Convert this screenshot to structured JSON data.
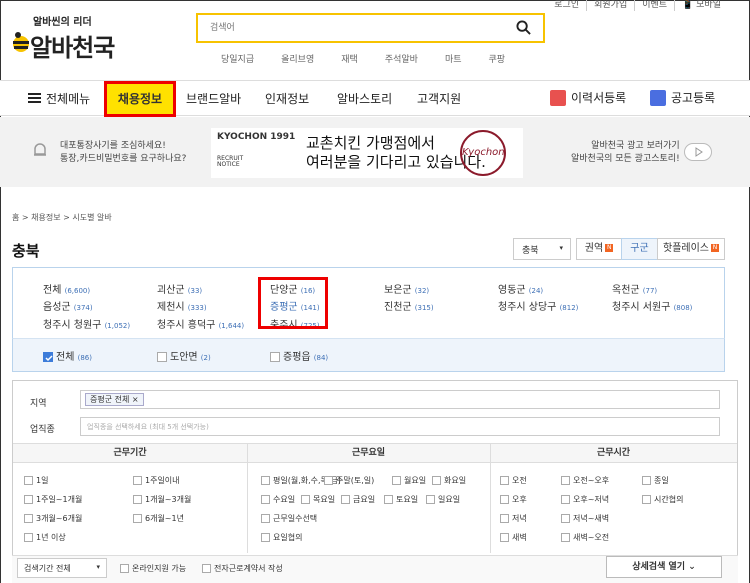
{
  "util_links": [
    "로그인",
    "회원가입",
    "이벤트",
    "모바일"
  ],
  "logo": {
    "tagline": "알바씬의 리더",
    "name": "알바천국"
  },
  "search": {
    "placeholder": "검색어"
  },
  "quick_links": [
    "당일지급",
    "올리브영",
    "재택",
    "주석알바",
    "마트",
    "쿠팡"
  ],
  "gnb": {
    "menu": "전체메뉴",
    "items": [
      "채용정보",
      "브랜드알바",
      "인재정보",
      "알바스토리",
      "고객지원"
    ],
    "resume": "이력서등록",
    "post": "공고등록"
  },
  "banner": {
    "left_line1": "대포통장사기를 조심하세요!",
    "left_line2": "통장,카드비밀번호를 요구하나요?",
    "ad_brand": "KYOCHON 1991",
    "ad_sub1": "RECRUIT",
    "ad_sub2": "NOTICE",
    "ad_line1": "교촌치킨 가맹점에서",
    "ad_line2": "여러분을 기다리고 있습니다.",
    "ad_logo": "Kyochon",
    "right_line1": "알바천국 광고 보러가기",
    "right_line2": "알바천국의 모든 광고스토리!"
  },
  "breadcrumb": "홈 > 채용정보 > 시도별 알바",
  "page_title": "충북",
  "controls": {
    "select": "충북",
    "tab1": "권역",
    "tab2": "구군",
    "tab3": "핫플레이스",
    "badge": "N"
  },
  "regions": [
    [
      {
        "name": "전체",
        "count": "(6,600)"
      },
      {
        "name": "괴산군",
        "count": "(33)"
      },
      {
        "name": "단양군",
        "count": "(16)"
      },
      {
        "name": "보은군",
        "count": "(32)"
      },
      {
        "name": "영동군",
        "count": "(24)"
      },
      {
        "name": "옥천군",
        "count": "(77)"
      }
    ],
    [
      {
        "name": "음성군",
        "count": "(374)"
      },
      {
        "name": "제천시",
        "count": "(333)"
      },
      {
        "name": "증평군",
        "count": "(141)"
      },
      {
        "name": "진천군",
        "count": "(315)"
      },
      {
        "name": "청주시 상당구",
        "count": "(812)"
      },
      {
        "name": "청주시 서원구",
        "count": "(808)"
      }
    ],
    [
      {
        "name": "청주시 청원구",
        "count": "(1,052)"
      },
      {
        "name": "청주시 흥덕구",
        "count": "(1,644)"
      },
      {
        "name": "충주시",
        "count": "(725)"
      }
    ]
  ],
  "sub_regions": [
    {
      "name": "전체",
      "count": "(86)",
      "checked": true
    },
    {
      "name": "도안면",
      "count": "(2)",
      "checked": false
    },
    {
      "name": "증평읍",
      "count": "(84)",
      "checked": false
    }
  ],
  "filter": {
    "region_label": "지역",
    "region_tag": "증평군 전체",
    "job_label": "업직종",
    "job_placeholder": "업직종을 선택하세요 (최대 5개 선택가능)",
    "period_head": "근무기간",
    "days_head": "근무요일",
    "time_head": "근무시간",
    "period": [
      "1일",
      "1주일이내",
      "1주일~1개월",
      "1개월~3개월",
      "3개월~6개월",
      "6개월~1년",
      "1년 이상"
    ],
    "days": [
      "평일(월,화,수,목,금)",
      "주말(토,일)",
      "월요일",
      "화요일",
      "수요일",
      "목요일",
      "금요일",
      "토요일",
      "일요일",
      "근무일수선택",
      "요일협의"
    ],
    "times": [
      "오전",
      "오전~오후",
      "종일",
      "오후",
      "오후~저녁",
      "시간협의",
      "저녁",
      "저녁~새벽",
      "새벽",
      "새벽~오전"
    ],
    "bottom_select": "검색기간 전체",
    "online": "온라인지원 가능",
    "contract": "전자근로계약서 작성",
    "detail": "상세검색 열기"
  }
}
